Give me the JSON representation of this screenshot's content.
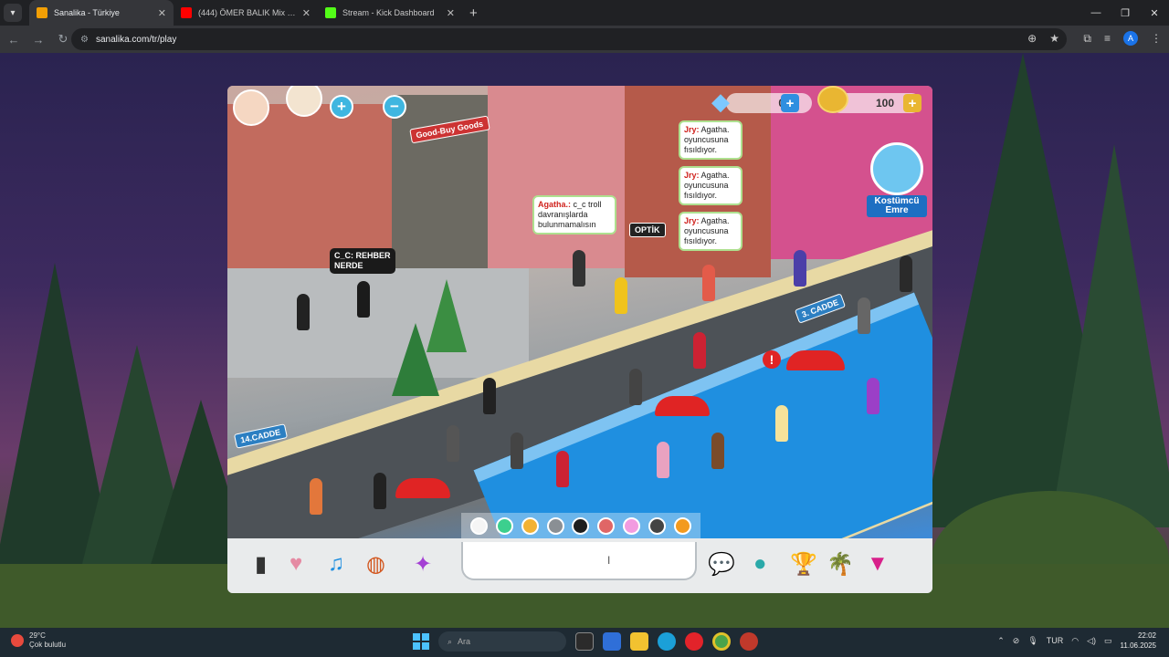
{
  "browser": {
    "tabs": [
      {
        "title": "Sanalika - Türkiye",
        "active": true,
        "favicon_color": "#f29f05"
      },
      {
        "title": "(444) ÖMER BALIK Mix - Best o",
        "active": false,
        "favicon_color": "#ff0000"
      },
      {
        "title": "Stream - Kick Dashboard",
        "active": false,
        "favicon_color": "#53fc18"
      }
    ],
    "url": "sanalika.com/tr/play"
  },
  "game": {
    "diamonds": "0",
    "coins": "100",
    "npc_name": "Kostümcü Emre",
    "bubbles": [
      {
        "name": "Jry:",
        "text": "Agatha. oyuncusuna fısıldıyor."
      },
      {
        "name": "Jry:",
        "text": "Agatha. oyuncusuna fısıldıyor."
      },
      {
        "name": "Jry:",
        "text": "Agatha. oyuncusuna fısıldıyor."
      },
      {
        "name": "Agatha.:",
        "text": "c_c troll davranışlarda bulunmamalısın"
      }
    ],
    "dark_bubble": "C_C: REHBER NERDE",
    "signs": {
      "street_14": "14.CADDE",
      "street_3": "3. CADDE",
      "goodbuy": "Good-Buy Goods",
      "optik": "OPTİK"
    },
    "palette_colors": [
      "#f5f5f5",
      "#3ccf8e",
      "#f2b233",
      "#8a8f94",
      "#1e1e1e",
      "#e06666",
      "#f29be0",
      "#444",
      "#f39a1e"
    ]
  },
  "taskbar": {
    "temp": "29°C",
    "weather": "Çok bulutlu",
    "search": "Ara",
    "lang": "TUR",
    "time": "22:02",
    "date": "11.06.2025"
  }
}
